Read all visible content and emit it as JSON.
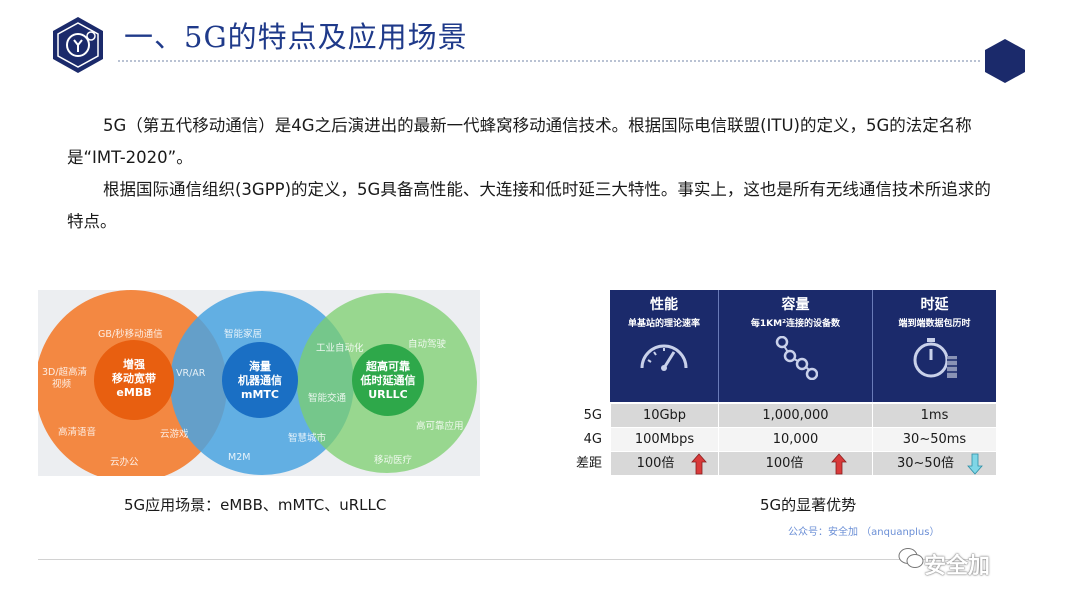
{
  "title": "一、5G的特点及应用场景",
  "paragraphs": [
    "5G（第五代移动通信）是4G之后演进出的最新一代蜂窝移动通信技术。根据国际电信联盟(ITU)的定义，5G的法定名称是“IMT-2020”。",
    "根据国际通信组织(3GPP)的定义，5G具备高性能、大连接和低时延三大特性。事实上，这也是所有无线通信技术所追求的特点。"
  ],
  "venn": {
    "embb": {
      "center": [
        "增强",
        "移动宽带",
        "eMBB"
      ],
      "labels": [
        "GB/秒移动通信",
        "3D/超高清",
        "视频",
        "高清语音",
        "云办公",
        "云游戏",
        "VR/AR"
      ]
    },
    "mmtc": {
      "center": [
        "海量",
        "机器通信",
        "mMTC"
      ],
      "labels": [
        "智能家居",
        "M2M",
        "智慧城市"
      ]
    },
    "urllc": {
      "center": [
        "超高可靠",
        "低时延通信",
        "URLLC"
      ],
      "labels": [
        "工业自动化",
        "自动驾驶",
        "智能交通",
        "高可靠应用",
        "移动医疗"
      ]
    },
    "colors": {
      "embb": "#f47c2f",
      "mmtc": "#4aa3e0",
      "urllc": "#7ccf6e"
    },
    "caption": "5G应用场景：eMBB、mMTC、uRLLC"
  },
  "table": {
    "columns": [
      {
        "title": "性能",
        "subtitle": "单基站的理论速率",
        "icon": "speedometer-icon"
      },
      {
        "title": "容量",
        "subtitle": "每1KM²连接的设备数",
        "icon": "chain-nodes-icon"
      },
      {
        "title": "时延",
        "subtitle": "端到端数据包历时",
        "icon": "stopwatch-icon"
      }
    ],
    "rows": [
      {
        "label": "5G",
        "values": [
          "10Gbp",
          "1,000,000",
          "1ms"
        ]
      },
      {
        "label": "4G",
        "values": [
          "100Mbps",
          "10,000",
          "30~50ms"
        ]
      },
      {
        "label": "差距",
        "values": [
          "100倍",
          "100倍",
          "30~50倍"
        ],
        "arrows": [
          "up",
          "up",
          "down"
        ]
      }
    ],
    "caption": "5G的显著优势",
    "header_color": "#1b2a6b",
    "arrow_up_color": "#d83a3a",
    "arrow_down_color": "#3ab0c8"
  },
  "watermark": {
    "small": "公众号：安全加 （anquanplus）",
    "brand": "安全加"
  }
}
